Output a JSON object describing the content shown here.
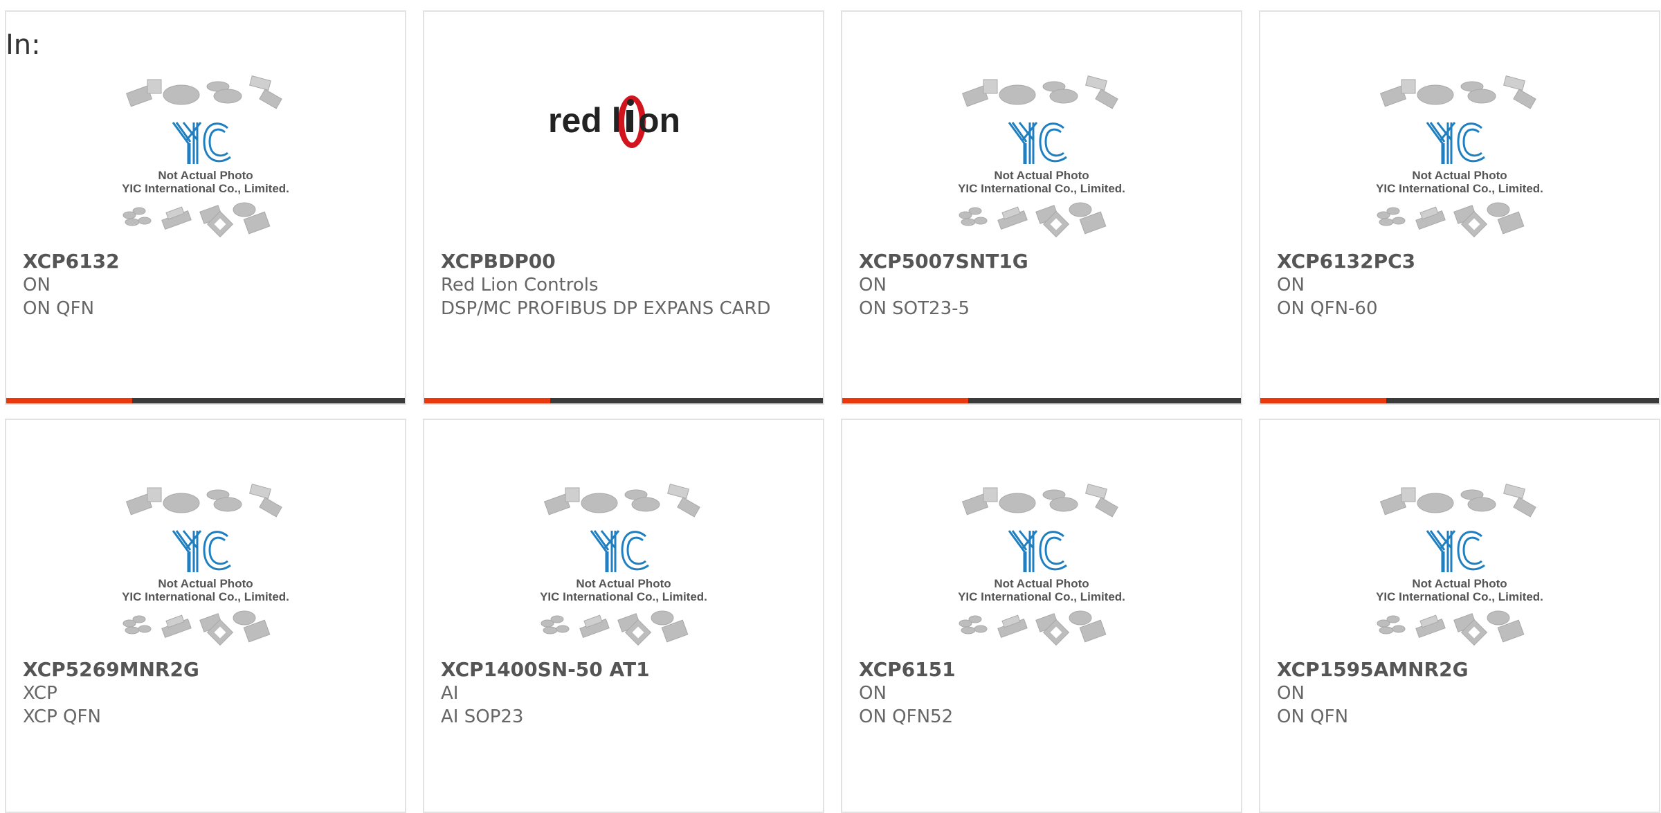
{
  "page": {
    "filter_label": "In:"
  },
  "placeholder": {
    "line1": "Not Actual Photo",
    "line2": "YIC International Co., Limited."
  },
  "cards": [
    {
      "part": "XCP6132",
      "brand": "ON",
      "desc": "ON QFN",
      "image": "yic-placeholder",
      "bar": true
    },
    {
      "part": "XCPBDP00",
      "brand": "Red Lion Controls",
      "desc": "DSP/MC PROFIBUS DP EXPANS CARD",
      "image": "red-lion-logo",
      "bar": true
    },
    {
      "part": "XCP5007SNT1G",
      "brand": "ON",
      "desc": "ON SOT23-5",
      "image": "yic-placeholder",
      "bar": true
    },
    {
      "part": "XCP6132PC3",
      "brand": "ON",
      "desc": "ON QFN-60",
      "image": "yic-placeholder",
      "bar": true
    },
    {
      "part": "XCP5269MNR2G",
      "brand": "XCP",
      "desc": "XCP QFN",
      "image": "yic-placeholder",
      "bar": false
    },
    {
      "part": "XCP1400SN-50 AT1",
      "brand": "AI",
      "desc": "AI SOP23",
      "image": "yic-placeholder",
      "bar": false
    },
    {
      "part": "XCP6151",
      "brand": "ON",
      "desc": "ON QFN52",
      "image": "yic-placeholder",
      "bar": false
    },
    {
      "part": "XCP1595AMNR2G",
      "brand": "ON",
      "desc": "ON QFN",
      "image": "yic-placeholder",
      "bar": false
    }
  ],
  "logo": {
    "red_lion_text_left": "red l",
    "red_lion_text_right": "on"
  },
  "colors": {
    "accent": "#e8380d",
    "bar_dark": "#3a3a3a",
    "yic_blue": "#1f7fc0",
    "red_lion_red": "#d2141e"
  }
}
